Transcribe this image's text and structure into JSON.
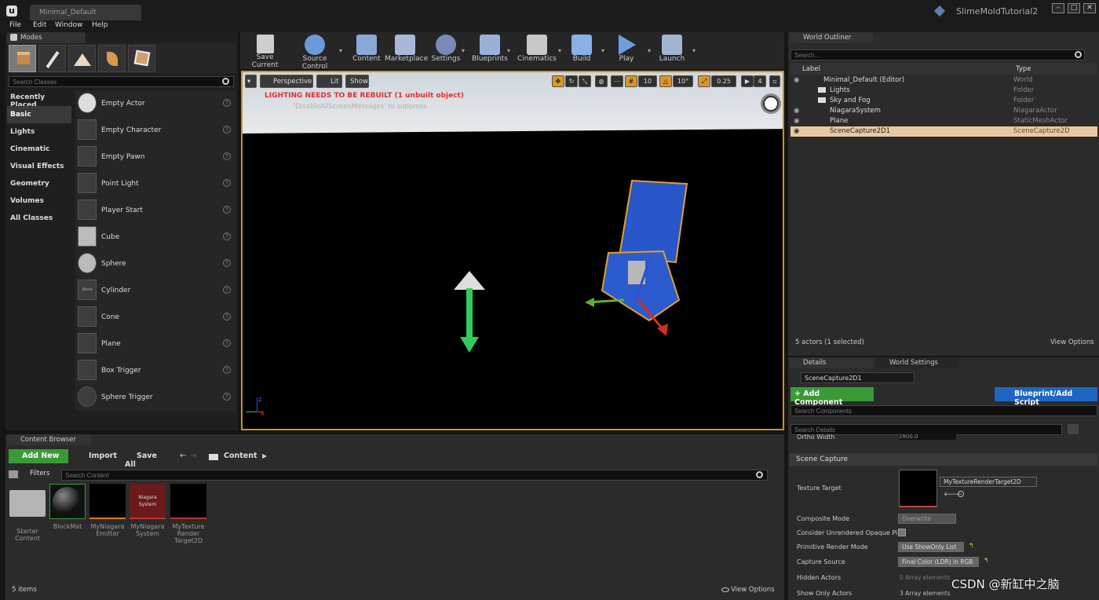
{
  "app": {
    "doc_tab": "Minimal_Default",
    "project": "SlimeMoldTutorial2"
  },
  "menu": [
    "File",
    "Edit",
    "Window",
    "Help"
  ],
  "modes": {
    "tab": "Modes",
    "search_placeholder": "Search Classes",
    "categories": [
      "Recently Placed",
      "Basic",
      "Lights",
      "Cinematic",
      "Visual Effects",
      "Geometry",
      "Volumes",
      "All Classes"
    ],
    "actors": [
      "Empty Actor",
      "Empty Character",
      "Empty Pawn",
      "Point Light",
      "Player Start",
      "Cube",
      "Sphere",
      "Cylinder",
      "Cone",
      "Plane",
      "Box Trigger",
      "Sphere Trigger"
    ],
    "cylinder_thumb": "None"
  },
  "toolbar": {
    "save": "Save Current",
    "source": "Source Control",
    "content": "Content",
    "market": "Marketplace",
    "settings": "Settings",
    "blueprints": "Blueprints",
    "cinematics": "Cinematics",
    "build": "Build",
    "play": "Play",
    "launch": "Launch"
  },
  "viewport": {
    "perspective": "Perspective",
    "lit": "Lit",
    "show": "Show",
    "grid": "10",
    "angle": "10°",
    "scale": "0.25",
    "speed": "4",
    "warning": "LIGHTING NEEDS TO BE REBUILT (1 unbuilt object)",
    "suppress": "'DisableAllScreenMessages' to suppress",
    "axis_z": "z",
    "axis_x": "x"
  },
  "outliner": {
    "tab": "World Outliner",
    "search": "Search...",
    "col_label": "Label",
    "col_type": "Type",
    "rows": [
      {
        "label": "Minimal_Default (Editor)",
        "type": "World"
      },
      {
        "label": "Lights",
        "type": "Folder"
      },
      {
        "label": "Sky and Fog",
        "type": "Folder"
      },
      {
        "label": "NiagaraSystem",
        "type": "NiagaraActor"
      },
      {
        "label": "Plane",
        "type": "StaticMeshActor"
      },
      {
        "label": "SceneCapture2D1",
        "type": "SceneCapture2D"
      }
    ],
    "status": "5 actors (1 selected)",
    "view_options": "View Options"
  },
  "details": {
    "tab": "Details",
    "tab2": "World Settings",
    "name": "SceneCapture2D1",
    "add_component": "+ Add Component",
    "blueprint": "Blueprint/Add Script",
    "search_components": "Search Components",
    "search_details": "Search Details",
    "ortho_width": "Ortho Width",
    "ortho_value": "2800.0",
    "section": "Scene Capture",
    "texture_target": "Texture Target",
    "texture_value": "MyTextureRenderTarget2D",
    "composite_mode": "Composite Mode",
    "composite_value": "Overwrite",
    "consider": "Consider Unrendered Opaque Pixe",
    "primitive_mode": "Primitive Render Mode",
    "primitive_value": "Use ShowOnly List",
    "capture_source": "Capture Source",
    "capture_value": "Final Color (LDR) in RGB",
    "hidden_actors": "Hidden Actors",
    "hidden_value": "0 Array elements",
    "show_only": "Show Only Actors",
    "show_only_value": "3 Array elements"
  },
  "content_browser": {
    "tab": "Content Browser",
    "add_new": "Add New",
    "import": "Import",
    "save_all": "Save All",
    "path": "Content",
    "filters": "Filters",
    "search": "Search Content",
    "assets": [
      {
        "name": "Starter Content",
        "thumb": ""
      },
      {
        "name": "BlockMat",
        "thumb": ""
      },
      {
        "name": "MyNiagara Emitter",
        "thumb": ""
      },
      {
        "name": "MyNiagara System",
        "thumb": "Niagara System"
      },
      {
        "name": "MyTexture Render Target2D",
        "thumb": ""
      }
    ],
    "count": "5 items",
    "view_options": "View Options"
  },
  "watermark": "CSDN @新缸中之脑"
}
